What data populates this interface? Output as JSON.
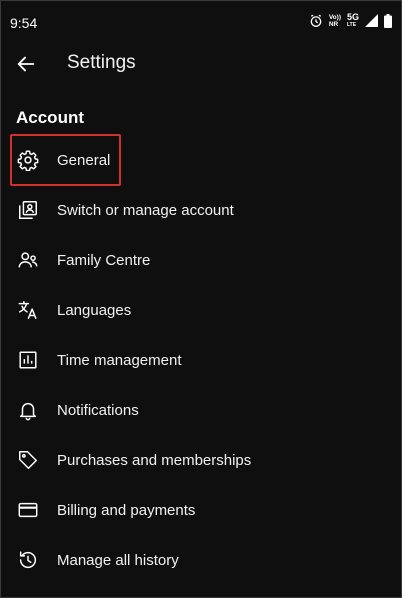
{
  "status_bar": {
    "time": "9:54",
    "net_top": "Vo))",
    "net_bottom": "NR",
    "network": "5G",
    "network_sub": "LTE"
  },
  "app_bar": {
    "title": "Settings"
  },
  "section": {
    "title": "Account"
  },
  "menu": {
    "items": [
      {
        "label": "General",
        "icon": "gear-icon"
      },
      {
        "label": "Switch or manage account",
        "icon": "switch-account-icon"
      },
      {
        "label": "Family Centre",
        "icon": "family-icon"
      },
      {
        "label": "Languages",
        "icon": "translate-icon"
      },
      {
        "label": "Time management",
        "icon": "bar-chart-icon"
      },
      {
        "label": "Notifications",
        "icon": "bell-icon"
      },
      {
        "label": "Purchases and memberships",
        "icon": "tag-icon"
      },
      {
        "label": "Billing and payments",
        "icon": "credit-card-icon"
      },
      {
        "label": "Manage all history",
        "icon": "history-icon"
      }
    ]
  },
  "colors": {
    "background": "#0f0f0f",
    "text": "#f1f1f1",
    "highlight": "#d32f2f"
  }
}
